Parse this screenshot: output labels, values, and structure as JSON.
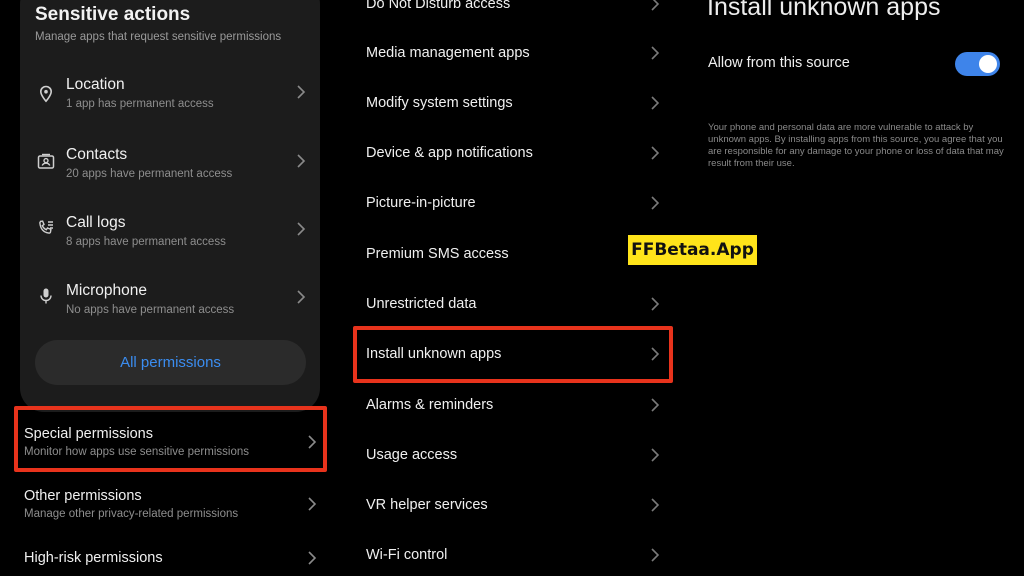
{
  "sensitive": {
    "title": "Sensitive actions",
    "subtitle": "Manage apps that request sensitive permissions",
    "items": [
      {
        "title": "Location",
        "subtitle": "1 app has permanent access",
        "icon": "location-pin-icon"
      },
      {
        "title": "Contacts",
        "subtitle": "20 apps have permanent access",
        "icon": "contact-card-icon"
      },
      {
        "title": "Call logs",
        "subtitle": "8 apps have permanent access",
        "icon": "call-log-icon"
      },
      {
        "title": "Microphone",
        "subtitle": "No apps have permanent access",
        "icon": "microphone-icon"
      }
    ],
    "all_permissions": "All permissions"
  },
  "left_rows": [
    {
      "title": "Special permissions",
      "subtitle": "Monitor how apps use sensitive permissions"
    },
    {
      "title": "Other permissions",
      "subtitle": "Manage other privacy-related permissions"
    },
    {
      "title": "High-risk permissions"
    }
  ],
  "special_list": [
    "Do Not Disturb access",
    "Media management apps",
    "Modify system settings",
    "Device & app notifications",
    "Picture-in-picture",
    "Premium SMS access",
    "Unrestricted data",
    "Install unknown apps",
    "Alarms & reminders",
    "Usage access",
    "VR helper services",
    "Wi-Fi control"
  ],
  "install": {
    "title": "Install unknown apps",
    "allow_label": "Allow from this source",
    "allow_on": true,
    "warning": "Your phone and personal data are more vulnerable to attack by unknown apps. By installing apps from this source, you agree that you are responsible for any damage to your phone or loss of data that may result from their use."
  },
  "watermark": "FFBetaa.App",
  "colors": {
    "accent": "#3e84ea",
    "link": "#3b8df0",
    "highlight": "#e8331c",
    "watermark_bg": "#ffe41a",
    "card_bg": "#1c1c1c"
  }
}
